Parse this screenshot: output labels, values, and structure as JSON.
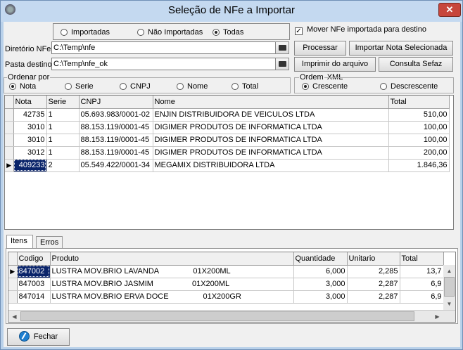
{
  "window": {
    "title": "Seleção de NFe a Importar",
    "close_glyph": "✕"
  },
  "filter": {
    "options": [
      "Importadas",
      "Não Importadas",
      "Todas"
    ],
    "selected": "Todas"
  },
  "move_checkbox": {
    "label": "Mover NFe importada para destino",
    "checked": true
  },
  "fields": {
    "diretorio_label": "Diretório NFe",
    "diretorio_value": "C:\\Temp\\nfe",
    "pasta_label": "Pasta destino",
    "pasta_value": "C:\\Temp\\nfe_ok"
  },
  "buttons": {
    "processar": "Processar",
    "importar": "Importar Nota Selecionada",
    "imprimir": "Imprimir do arquivo XML",
    "consulta": "Consulta Sefaz",
    "fechar": "Fechar"
  },
  "ordenar": {
    "label": "Ordenar por",
    "options": [
      "Nota",
      "Serie",
      "CNPJ",
      "Nome",
      "Total"
    ],
    "selected": "Nota"
  },
  "ordem": {
    "label": "Ordem",
    "options": [
      "Crescente",
      "Descrescente"
    ],
    "selected": "Crescente"
  },
  "notas_grid": {
    "columns": [
      "Nota",
      "Serie",
      "CNPJ",
      "Nome",
      "Total"
    ],
    "rows": [
      [
        "42735",
        "1",
        "05.693.983/0001-02",
        "ENJIN DISTRIBUIDORA DE VEICULOS LTDA",
        "510,00"
      ],
      [
        "3010",
        "1",
        "88.153.119/0001-45",
        "DIGIMER PRODUTOS DE INFORMATICA LTDA",
        "100,00"
      ],
      [
        "3010",
        "1",
        "88.153.119/0001-45",
        "DIGIMER PRODUTOS DE INFORMATICA LTDA",
        "100,00"
      ],
      [
        "3012",
        "1",
        "88.153.119/0001-45",
        "DIGIMER PRODUTOS DE INFORMATICA LTDA",
        "200,00"
      ],
      [
        "409233",
        "2",
        "05.549.422/0001-34",
        "MEGAMIX DISTRIBUIDORA LTDA",
        "1.846,36"
      ]
    ],
    "selected_row": 4
  },
  "tabs": [
    "Itens",
    "Erros"
  ],
  "active_tab": "Itens",
  "itens_grid": {
    "columns": [
      "Codigo",
      "Produto",
      "Quantidade",
      "Unitario",
      "Total"
    ],
    "rows": [
      [
        "847002",
        "LUSTRA MOV.BRIO LAVANDA                01X200ML",
        "6,000",
        "2,285",
        "13,7"
      ],
      [
        "847003",
        "LUSTRA MOV.BRIO JASMIM                  01X200ML",
        "3,000",
        "2,287",
        "6,9"
      ],
      [
        "847014",
        "LUSTRA MOV.BRIO ERVA DOCE                01X200GR",
        "3,000",
        "2,287",
        "6,9"
      ]
    ],
    "selected_row": 0
  },
  "icons": {
    "app": "app-icon",
    "folder": "folder-open-icon",
    "row_pointer": "row-pointer-icon",
    "fechar": "close-circle-icon"
  },
  "colors": {
    "title_bar": "#c4d9f0",
    "close_button": "#c7463c",
    "selection": "#0a246a",
    "client_bg": "#f0f0f0"
  }
}
